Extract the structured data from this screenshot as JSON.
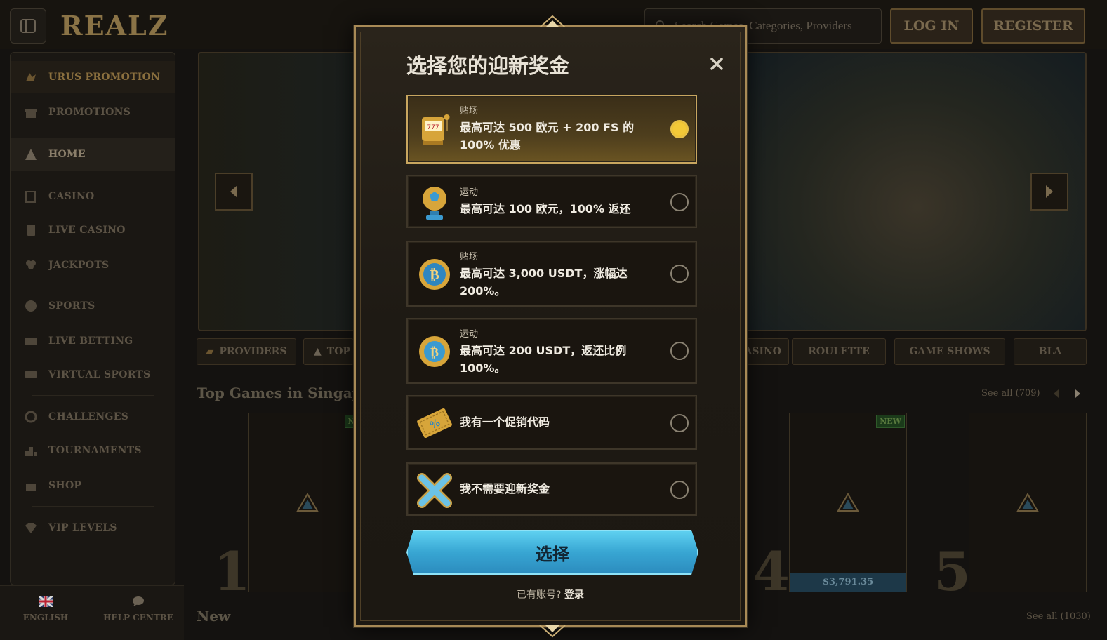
{
  "header": {
    "logo": "REALZ",
    "search_placeholder": "Search Games, Categories, Providers",
    "login": "LOG IN",
    "register": "REGISTER"
  },
  "sidebar": {
    "items": [
      {
        "label": "URUS PROMOTION",
        "icon": "bull-icon"
      },
      {
        "label": "PROMOTIONS",
        "icon": "gift-icon"
      },
      {
        "label": "HOME",
        "icon": "pyramid-icon"
      },
      {
        "label": "CASINO",
        "icon": "slot-icon"
      },
      {
        "label": "LIVE CASINO",
        "icon": "card-icon"
      },
      {
        "label": "JACKPOTS",
        "icon": "clover-icon"
      },
      {
        "label": "SPORTS",
        "icon": "ball-icon"
      },
      {
        "label": "LIVE BETTING",
        "icon": "live-icon"
      },
      {
        "label": "VIRTUAL SPORTS",
        "icon": "virtual-icon"
      },
      {
        "label": "CHALLENGES",
        "icon": "challenge-icon"
      },
      {
        "label": "TOURNAMENTS",
        "icon": "podium-icon"
      },
      {
        "label": "SHOP",
        "icon": "bag-icon"
      },
      {
        "label": "VIP LEVELS",
        "icon": "diamond-icon"
      }
    ],
    "language": "ENGLISH",
    "help": "HELP CENTRE"
  },
  "categories": [
    {
      "label": "PROVIDERS"
    },
    {
      "label": "TOP"
    },
    {
      "label": "ASINO"
    },
    {
      "label": "ROULETTE"
    },
    {
      "label": "GAME SHOWS"
    },
    {
      "label": "BLA"
    }
  ],
  "top_games": {
    "title": "Top Games in Singapore",
    "see_all": "See all (709)",
    "ranks": [
      "1",
      "4",
      "5"
    ],
    "new_badge": "NEW",
    "truncated_badge": "NE",
    "jackpot": "$3,791.35"
  },
  "new_section": {
    "title": "New",
    "see_all": "See all (1030)"
  },
  "modal": {
    "title": "选择您的迎新奖金",
    "options": [
      {
        "category": "赌场",
        "text": "最高可达 500 欧元 + 200 FS 的 100% 优惠",
        "icon": "slot-machine-icon",
        "selected": true
      },
      {
        "category": "运动",
        "text": "最高可达 100 欧元，100% 返还",
        "icon": "football-trophy-icon",
        "selected": false
      },
      {
        "category": "赌场",
        "text": "最高可达 3,000 USDT，涨幅达 200%。",
        "icon": "bitcoin-coin-icon",
        "selected": false
      },
      {
        "category": "运动",
        "text": "最高可达 200 USDT，返还比例 100%。",
        "icon": "bitcoin-football-icon",
        "selected": false
      },
      {
        "category": "",
        "text": "我有一个促销代码",
        "icon": "promo-ticket-icon",
        "selected": false
      },
      {
        "category": "",
        "text": "我不需要迎新奖金",
        "icon": "x-mark-icon",
        "selected": false
      }
    ],
    "select_button": "选择",
    "login_prompt": "已有账号?",
    "login_link": "登录"
  },
  "colors": {
    "accent_gold": "#c8a65f",
    "button_blue": "#38a6d3",
    "radio_selected": "#f3c938"
  }
}
